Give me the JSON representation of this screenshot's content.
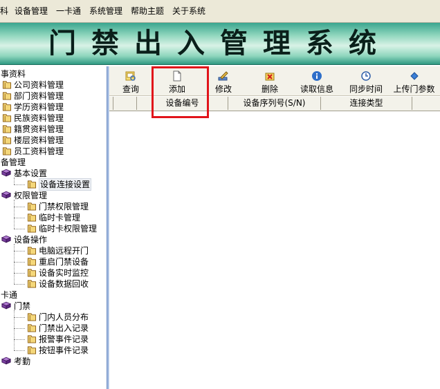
{
  "menubar": {
    "items": [
      "科",
      "设备管理",
      "一卡通",
      "系统管理",
      "帮助主题",
      "关于系统"
    ]
  },
  "banner": {
    "title": "门禁出入管理系统"
  },
  "sidebar": {
    "nodes": [
      {
        "label": "事资料",
        "icon": "none",
        "level": 0
      },
      {
        "label": "公司资料管理",
        "icon": "folder-icon",
        "level": 1
      },
      {
        "label": "部门资料管理",
        "icon": "folder-icon",
        "level": 1
      },
      {
        "label": "学历资料管理",
        "icon": "folder-icon",
        "level": 1
      },
      {
        "label": "民族资料管理",
        "icon": "folder-icon",
        "level": 1
      },
      {
        "label": "籍贯资料管理",
        "icon": "folder-icon",
        "level": 1
      },
      {
        "label": "楼层资料管理",
        "icon": "folder-icon",
        "level": 1
      },
      {
        "label": "员工资料管理",
        "icon": "folder-icon",
        "level": 1
      },
      {
        "label": "备管理",
        "icon": "none",
        "level": 0
      },
      {
        "label": "基本设置",
        "icon": "book-icon",
        "level": 1
      },
      {
        "label": "设备连接设置",
        "icon": "folder-icon",
        "level": 2,
        "selected": true
      },
      {
        "label": "权限管理",
        "icon": "book-icon",
        "level": 1
      },
      {
        "label": "门禁权限管理",
        "icon": "folder-icon",
        "level": 2
      },
      {
        "label": "临时卡管理",
        "icon": "folder-icon",
        "level": 2
      },
      {
        "label": "临时卡权限管理",
        "icon": "folder-icon",
        "level": 2
      },
      {
        "label": "设备操作",
        "icon": "book-icon",
        "level": 1
      },
      {
        "label": "电脑远程开门",
        "icon": "folder-icon",
        "level": 2
      },
      {
        "label": "重启门禁设备",
        "icon": "folder-icon",
        "level": 2
      },
      {
        "label": "设备实时监控",
        "icon": "folder-icon",
        "level": 2
      },
      {
        "label": "设备数据回收",
        "icon": "folder-icon",
        "level": 2
      },
      {
        "label": "卡通",
        "icon": "none",
        "level": 0
      },
      {
        "label": "门禁",
        "icon": "book-icon",
        "level": 1
      },
      {
        "label": "门内人员分布",
        "icon": "folder-icon",
        "level": 2
      },
      {
        "label": "门禁出入记录",
        "icon": "folder-icon",
        "level": 2
      },
      {
        "label": "报警事件记录",
        "icon": "folder-icon",
        "level": 2
      },
      {
        "label": "按钮事件记录",
        "icon": "folder-icon",
        "level": 2
      },
      {
        "label": "考勤",
        "icon": "book-icon",
        "level": 1
      }
    ]
  },
  "toolbar": {
    "buttons": [
      {
        "label": "查询",
        "icon": "query-icon"
      },
      {
        "label": "添加",
        "icon": "add-icon"
      },
      {
        "label": "修改",
        "icon": "edit-icon"
      },
      {
        "label": "删除",
        "icon": "delete-icon"
      },
      {
        "label": "读取信息",
        "icon": "info-icon"
      },
      {
        "label": "同步时间",
        "icon": "clock-icon"
      },
      {
        "label": "上传门参数",
        "icon": "upload-icon"
      }
    ]
  },
  "grid": {
    "columns": [
      "设备编号",
      "设备序列号(S/N)",
      "连接类型"
    ]
  },
  "colors": {
    "highlight": "#e1141a",
    "banner": "#5fbfa5",
    "toolbar": "#f3f2ea",
    "divider": "#9fb7de"
  }
}
